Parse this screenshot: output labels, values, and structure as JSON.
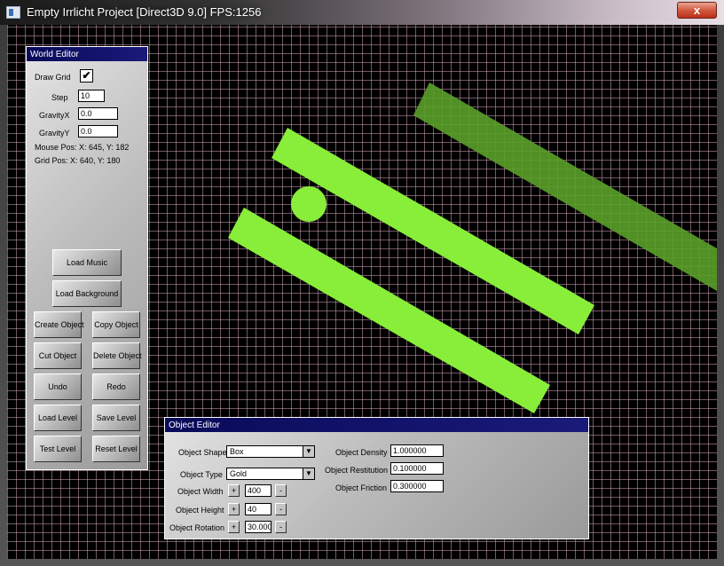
{
  "window": {
    "title": "Empty Irrlicht Project [Direct3D 9.0] FPS:1256",
    "close_label": "x"
  },
  "colors": {
    "grid": "#cda0b4",
    "shape_fill": "#88ee3a",
    "shape_dim": "#5aa028",
    "panel_title": "#0a0a5a"
  },
  "world_editor": {
    "title": "World Editor",
    "draw_grid_label": "Draw Grid",
    "draw_grid_checked": "✔",
    "step_label": "Step",
    "step_value": "10",
    "gravity_x_label": "GravityX",
    "gravity_x_value": "0.0",
    "gravity_y_label": "GravityY",
    "gravity_y_value": "0.0",
    "mouse_pos": "Mouse Pos: X: 645, Y: 182",
    "grid_pos": "Grid Pos: X: 640, Y: 180",
    "buttons": {
      "load_music": "Load Music",
      "load_background": "Load Background",
      "create_object": "Create Object",
      "copy_object": "Copy Object",
      "cut_object": "Cut Object",
      "delete_object": "Delete Object",
      "undo": "Undo",
      "redo": "Redo",
      "load_level": "Load Level",
      "save_level": "Save Level",
      "test_level": "Test Level",
      "reset_level": "Reset Level"
    }
  },
  "object_editor": {
    "title": "Object Editor",
    "shape_label": "Object Shape",
    "shape_value": "Box",
    "type_label": "Object Type",
    "type_value": "Gold",
    "width_label": "Object Width",
    "width_value": "400",
    "height_label": "Object Height",
    "height_value": "40",
    "rotation_label": "Object Rotation",
    "rotation_value": "30.000",
    "density_label": "Object Density",
    "density_value": "1.000000",
    "restitution_label": "Object Restitution",
    "restitution_value": "0.100000",
    "friction_label": "Object Friction",
    "friction_value": "0.300000",
    "plus": "+",
    "minus": "-",
    "arrow": "▼"
  }
}
